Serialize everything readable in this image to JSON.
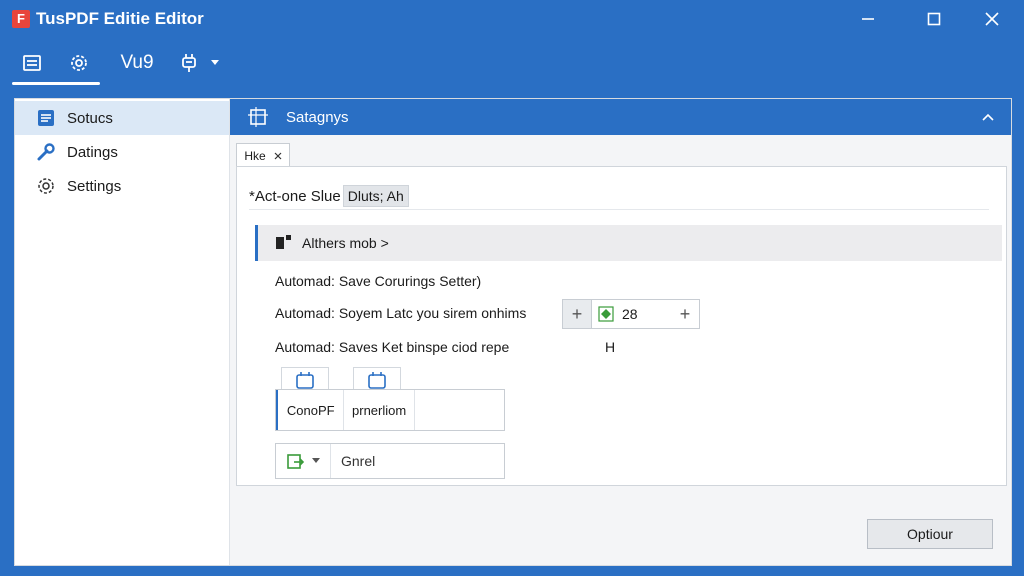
{
  "window": {
    "title": "TusPDF Editie Editor",
    "logo_letter": "F"
  },
  "toolbar": {
    "items": [
      {
        "icon": "document-icon"
      },
      {
        "icon": "gear-scan-icon"
      },
      {
        "label": "Vu9"
      },
      {
        "icon": "plugin-icon"
      }
    ]
  },
  "sidebar": {
    "items": [
      {
        "label": "Sotucs",
        "icon": "document-lines-icon"
      },
      {
        "label": "Datings",
        "icon": "wrench-icon"
      },
      {
        "label": "Settings",
        "icon": "gear-icon"
      }
    ]
  },
  "category": {
    "title": "Satagnys",
    "icon": "settings-frame-icon"
  },
  "tab": {
    "label": "Hke"
  },
  "panel": {
    "act_label": "*Act-one Slue",
    "act_chip": "Dluts; Ah",
    "section_title": "Althers mob >",
    "options": [
      "Automad: Save Corurings Setter)",
      "Automad: Soyem Latc you sirem onhims",
      "Automad: Saves Ket binspe ciod repe"
    ],
    "stepper": {
      "minus": "+",
      "value": "28",
      "plus": "+"
    },
    "h_label": "H",
    "field_group": [
      "ConoPF",
      "prnerliom",
      ""
    ],
    "combo_text": "Gnrel",
    "option_button": "Optiour"
  },
  "colors": {
    "accent": "#2a6fc4",
    "logo": "#e8453c",
    "green": "#3a9b3a"
  }
}
